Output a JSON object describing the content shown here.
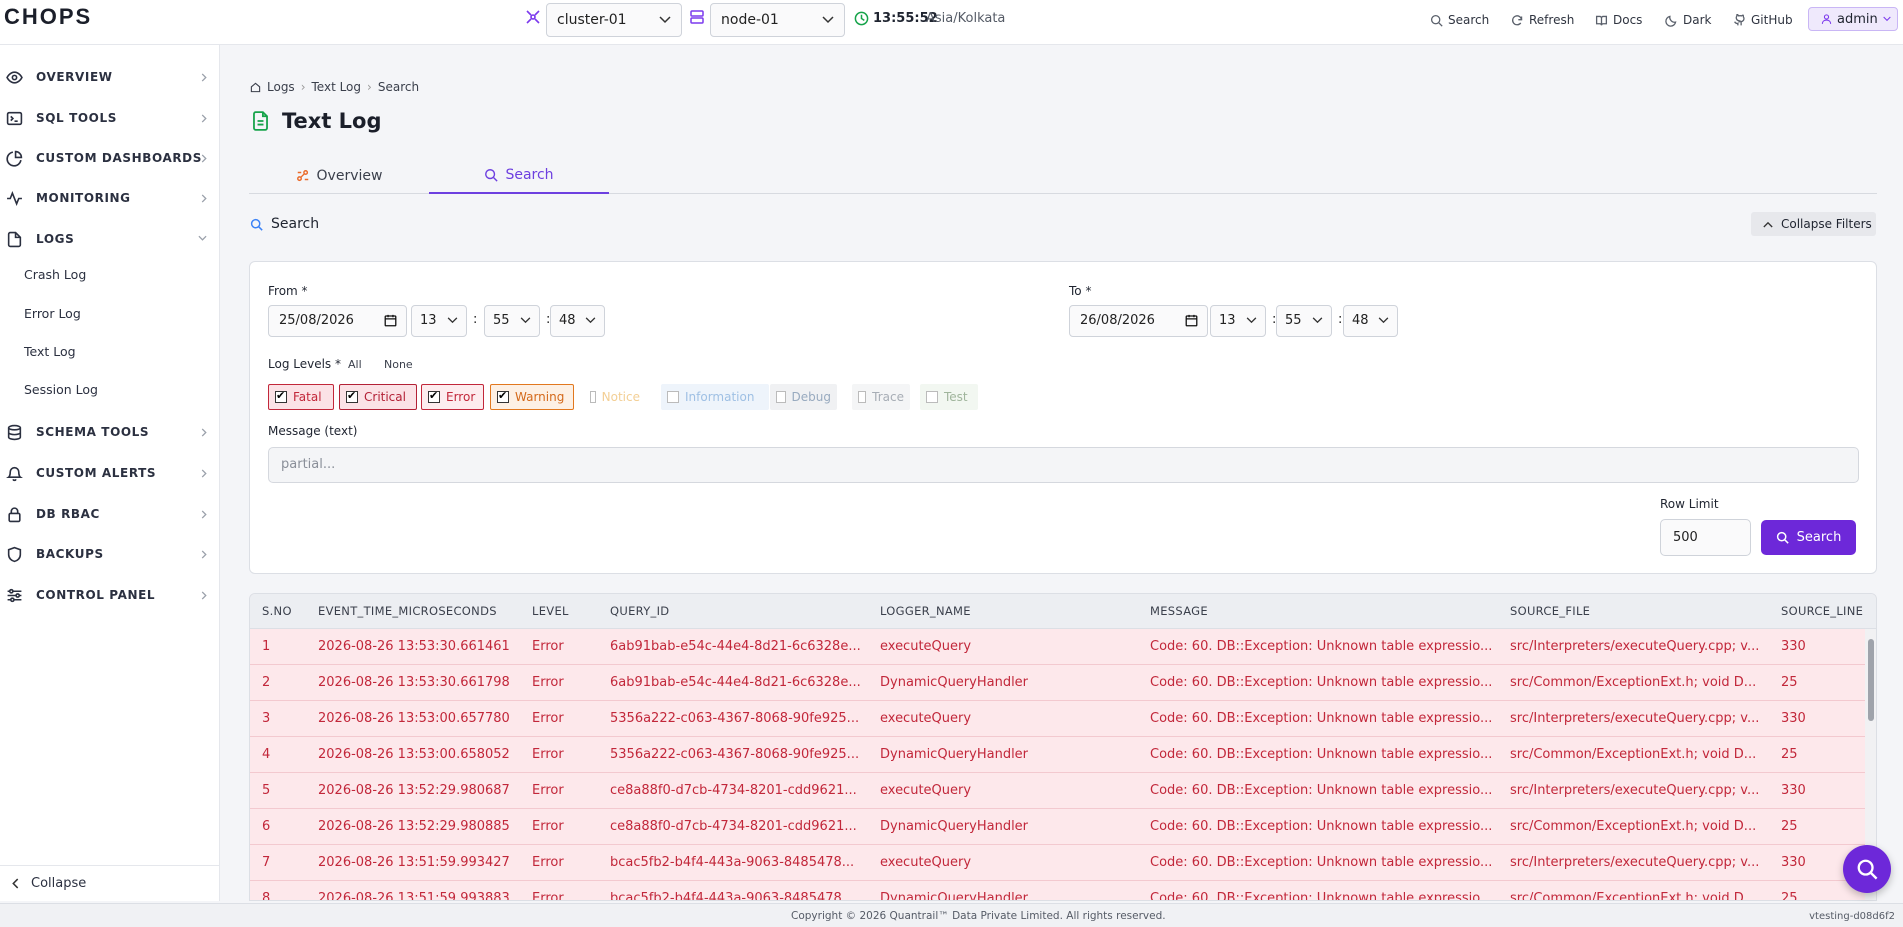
{
  "app": {
    "logo": "CHOPS"
  },
  "topbar": {
    "cluster": "cluster-01",
    "node": "node-01",
    "time": "13:55:52",
    "timezone": "Asia/Kolkata",
    "buttons": {
      "search": "Search",
      "refresh": "Refresh",
      "docs": "Docs",
      "dark": "Dark",
      "github": "GitHub"
    },
    "user": "admin"
  },
  "sidebar": {
    "items": [
      {
        "label": "OVERVIEW",
        "icon": "eye-icon"
      },
      {
        "label": "SQL TOOLS",
        "icon": "terminal-icon"
      },
      {
        "label": "CUSTOM DASHBOARDS",
        "icon": "pie-chart-icon"
      },
      {
        "label": "MONITORING",
        "icon": "activity-icon"
      },
      {
        "label": "LOGS",
        "icon": "file-icon"
      },
      {
        "label": "SCHEMA TOOLS",
        "icon": "database-icon"
      },
      {
        "label": "CUSTOM ALERTS",
        "icon": "bell-icon"
      },
      {
        "label": "DB RBAC",
        "icon": "lock-icon"
      },
      {
        "label": "BACKUPS",
        "icon": "shield-icon"
      },
      {
        "label": "CONTROL PANEL",
        "icon": "sliders-icon"
      }
    ],
    "logs_sub": [
      "Crash Log",
      "Error Log",
      "Text Log",
      "Session Log"
    ],
    "collapse": "Collapse"
  },
  "breadcrumb": [
    "Logs",
    "Text Log",
    "Search"
  ],
  "page_title": "Text Log",
  "tabs": [
    {
      "label": "Overview"
    },
    {
      "label": "Search"
    }
  ],
  "search_section": {
    "title": "Search",
    "collapse_label": "Collapse Filters"
  },
  "filters": {
    "from_label": "From *",
    "to_label": "To *",
    "from": {
      "date": "25/08/2026",
      "hh": "13",
      "mm": "55",
      "ss": "48"
    },
    "to": {
      "date": "26/08/2026",
      "hh": "13",
      "mm": "55",
      "ss": "48"
    },
    "log_levels_label": "Log Levels *",
    "all_label": "All",
    "none_label": "None",
    "levels": [
      {
        "label": "Fatal",
        "checked": true
      },
      {
        "label": "Critical",
        "checked": true
      },
      {
        "label": "Error",
        "checked": true
      },
      {
        "label": "Warning",
        "checked": true
      },
      {
        "label": "Notice",
        "checked": false
      },
      {
        "label": "Information",
        "checked": false
      },
      {
        "label": "Debug",
        "checked": false
      },
      {
        "label": "Trace",
        "checked": false
      },
      {
        "label": "Test",
        "checked": false
      }
    ],
    "message_label": "Message (text)",
    "message_placeholder": "partial...",
    "row_limit_label": "Row Limit",
    "row_limit": "500",
    "search_button": "Search"
  },
  "table": {
    "columns": [
      "S.NO",
      "EVENT_TIME_MICROSECONDS",
      "LEVEL",
      "QUERY_ID",
      "LOGGER_NAME",
      "MESSAGE",
      "SOURCE_FILE",
      "SOURCE_LINE"
    ],
    "rows": [
      [
        "1",
        "2026-08-26 13:53:30.661461",
        "Error",
        "6ab91bab-e54c-44e4-8d21-6c6328e...",
        "executeQuery",
        "Code: 60. DB::Exception: Unknown table expressio...",
        "src/Interpreters/executeQuery.cpp; v...",
        "330"
      ],
      [
        "2",
        "2026-08-26 13:53:30.661798",
        "Error",
        "6ab91bab-e54c-44e4-8d21-6c6328e...",
        "DynamicQueryHandler",
        "Code: 60. DB::Exception: Unknown table expressio...",
        "src/Common/ExceptionExt.h; void D...",
        "25"
      ],
      [
        "3",
        "2026-08-26 13:53:00.657780",
        "Error",
        "5356a222-c063-4367-8068-90fe925...",
        "executeQuery",
        "Code: 60. DB::Exception: Unknown table expressio...",
        "src/Interpreters/executeQuery.cpp; v...",
        "330"
      ],
      [
        "4",
        "2026-08-26 13:53:00.658052",
        "Error",
        "5356a222-c063-4367-8068-90fe925...",
        "DynamicQueryHandler",
        "Code: 60. DB::Exception: Unknown table expressio...",
        "src/Common/ExceptionExt.h; void D...",
        "25"
      ],
      [
        "5",
        "2026-08-26 13:52:29.980687",
        "Error",
        "ce8a88f0-d7cb-4734-8201-cdd9621...",
        "executeQuery",
        "Code: 60. DB::Exception: Unknown table expressio...",
        "src/Interpreters/executeQuery.cpp; v...",
        "330"
      ],
      [
        "6",
        "2026-08-26 13:52:29.980885",
        "Error",
        "ce8a88f0-d7cb-4734-8201-cdd9621...",
        "DynamicQueryHandler",
        "Code: 60. DB::Exception: Unknown table expressio...",
        "src/Common/ExceptionExt.h; void D...",
        "25"
      ],
      [
        "7",
        "2026-08-26 13:51:59.993427",
        "Error",
        "bcac5fb2-b4f4-443a-9063-8485478...",
        "executeQuery",
        "Code: 60. DB::Exception: Unknown table expressio...",
        "src/Interpreters/executeQuery.cpp; v...",
        "330"
      ],
      [
        "8",
        "2026-08-26 13:51:59.993883",
        "Error",
        "bcac5fb2-b4f4-443a-9063-8485478...",
        "DynamicQueryHandler",
        "Code: 60. DB::Exception: Unknown table expressio...",
        "src/Common/ExceptionExt.h; void D...",
        "25"
      ]
    ]
  },
  "footer": {
    "copyright": "Copyright © 2026 Quantrail™ Data Private Limited. All rights reserved.",
    "version": "vtesting-d08d6f2"
  },
  "colors": {
    "accent": "#6d28d9",
    "error_text": "#c2273a",
    "row_bg": "#fde8eb"
  }
}
